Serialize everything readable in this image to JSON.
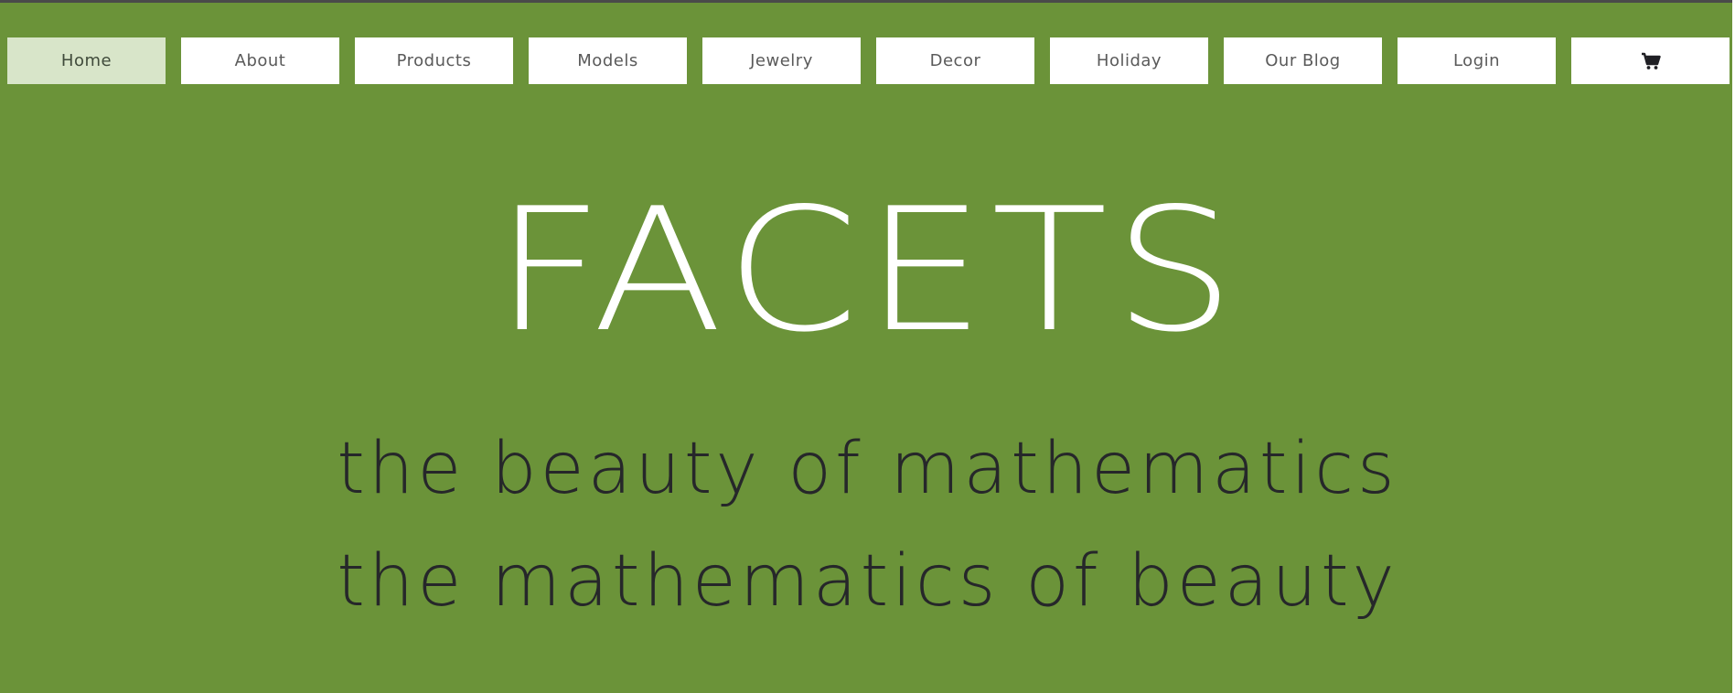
{
  "nav": {
    "items": [
      {
        "label": "Home",
        "active": true
      },
      {
        "label": "About"
      },
      {
        "label": "Products"
      },
      {
        "label": "Models"
      },
      {
        "label": "Jewelry"
      },
      {
        "label": "Decor"
      },
      {
        "label": "Holiday"
      },
      {
        "label": "Our Blog"
      },
      {
        "label": "Login"
      }
    ],
    "cart_icon": "shopping-cart-icon"
  },
  "hero": {
    "title": "FACETS",
    "tagline_1": "the beauty of mathematics",
    "tagline_2": "the mathematics of beauty"
  },
  "colors": {
    "background": "#6b9339",
    "nav_active_bg": "#d8e5c9",
    "nav_bg": "#ffffff",
    "title_text": "#ffffff",
    "tagline_text": "#26272a"
  }
}
